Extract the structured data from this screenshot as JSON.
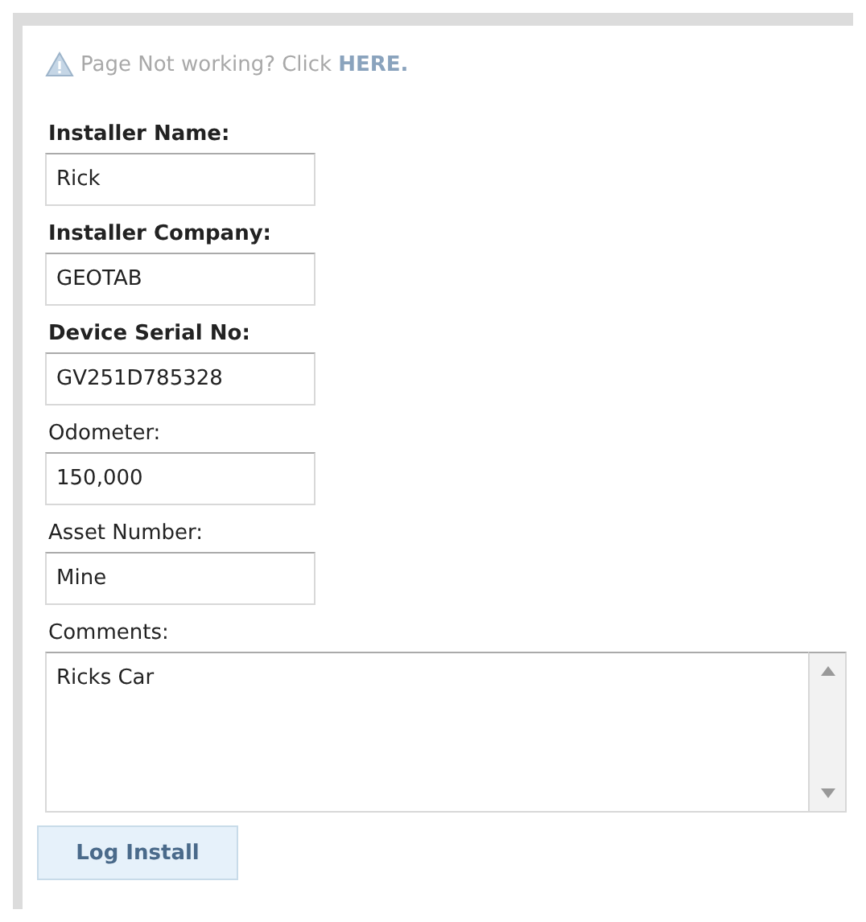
{
  "notice": {
    "text": "Page Not working? Click",
    "link": "HERE."
  },
  "fields": [
    {
      "label": "Installer Name:",
      "bold": true,
      "value": "Rick"
    },
    {
      "label": "Installer Company:",
      "bold": true,
      "value": "GEOTAB"
    },
    {
      "label": "Device Serial No:",
      "bold": true,
      "value": "GV251D785328"
    },
    {
      "label": "Odometer:",
      "bold": false,
      "value": "150,000"
    },
    {
      "label": "Asset Number:",
      "bold": false,
      "value": "Mine"
    }
  ],
  "comments": {
    "label": "Comments:",
    "value": "Ricks Car"
  },
  "buttons": [
    "Log Install"
  ]
}
